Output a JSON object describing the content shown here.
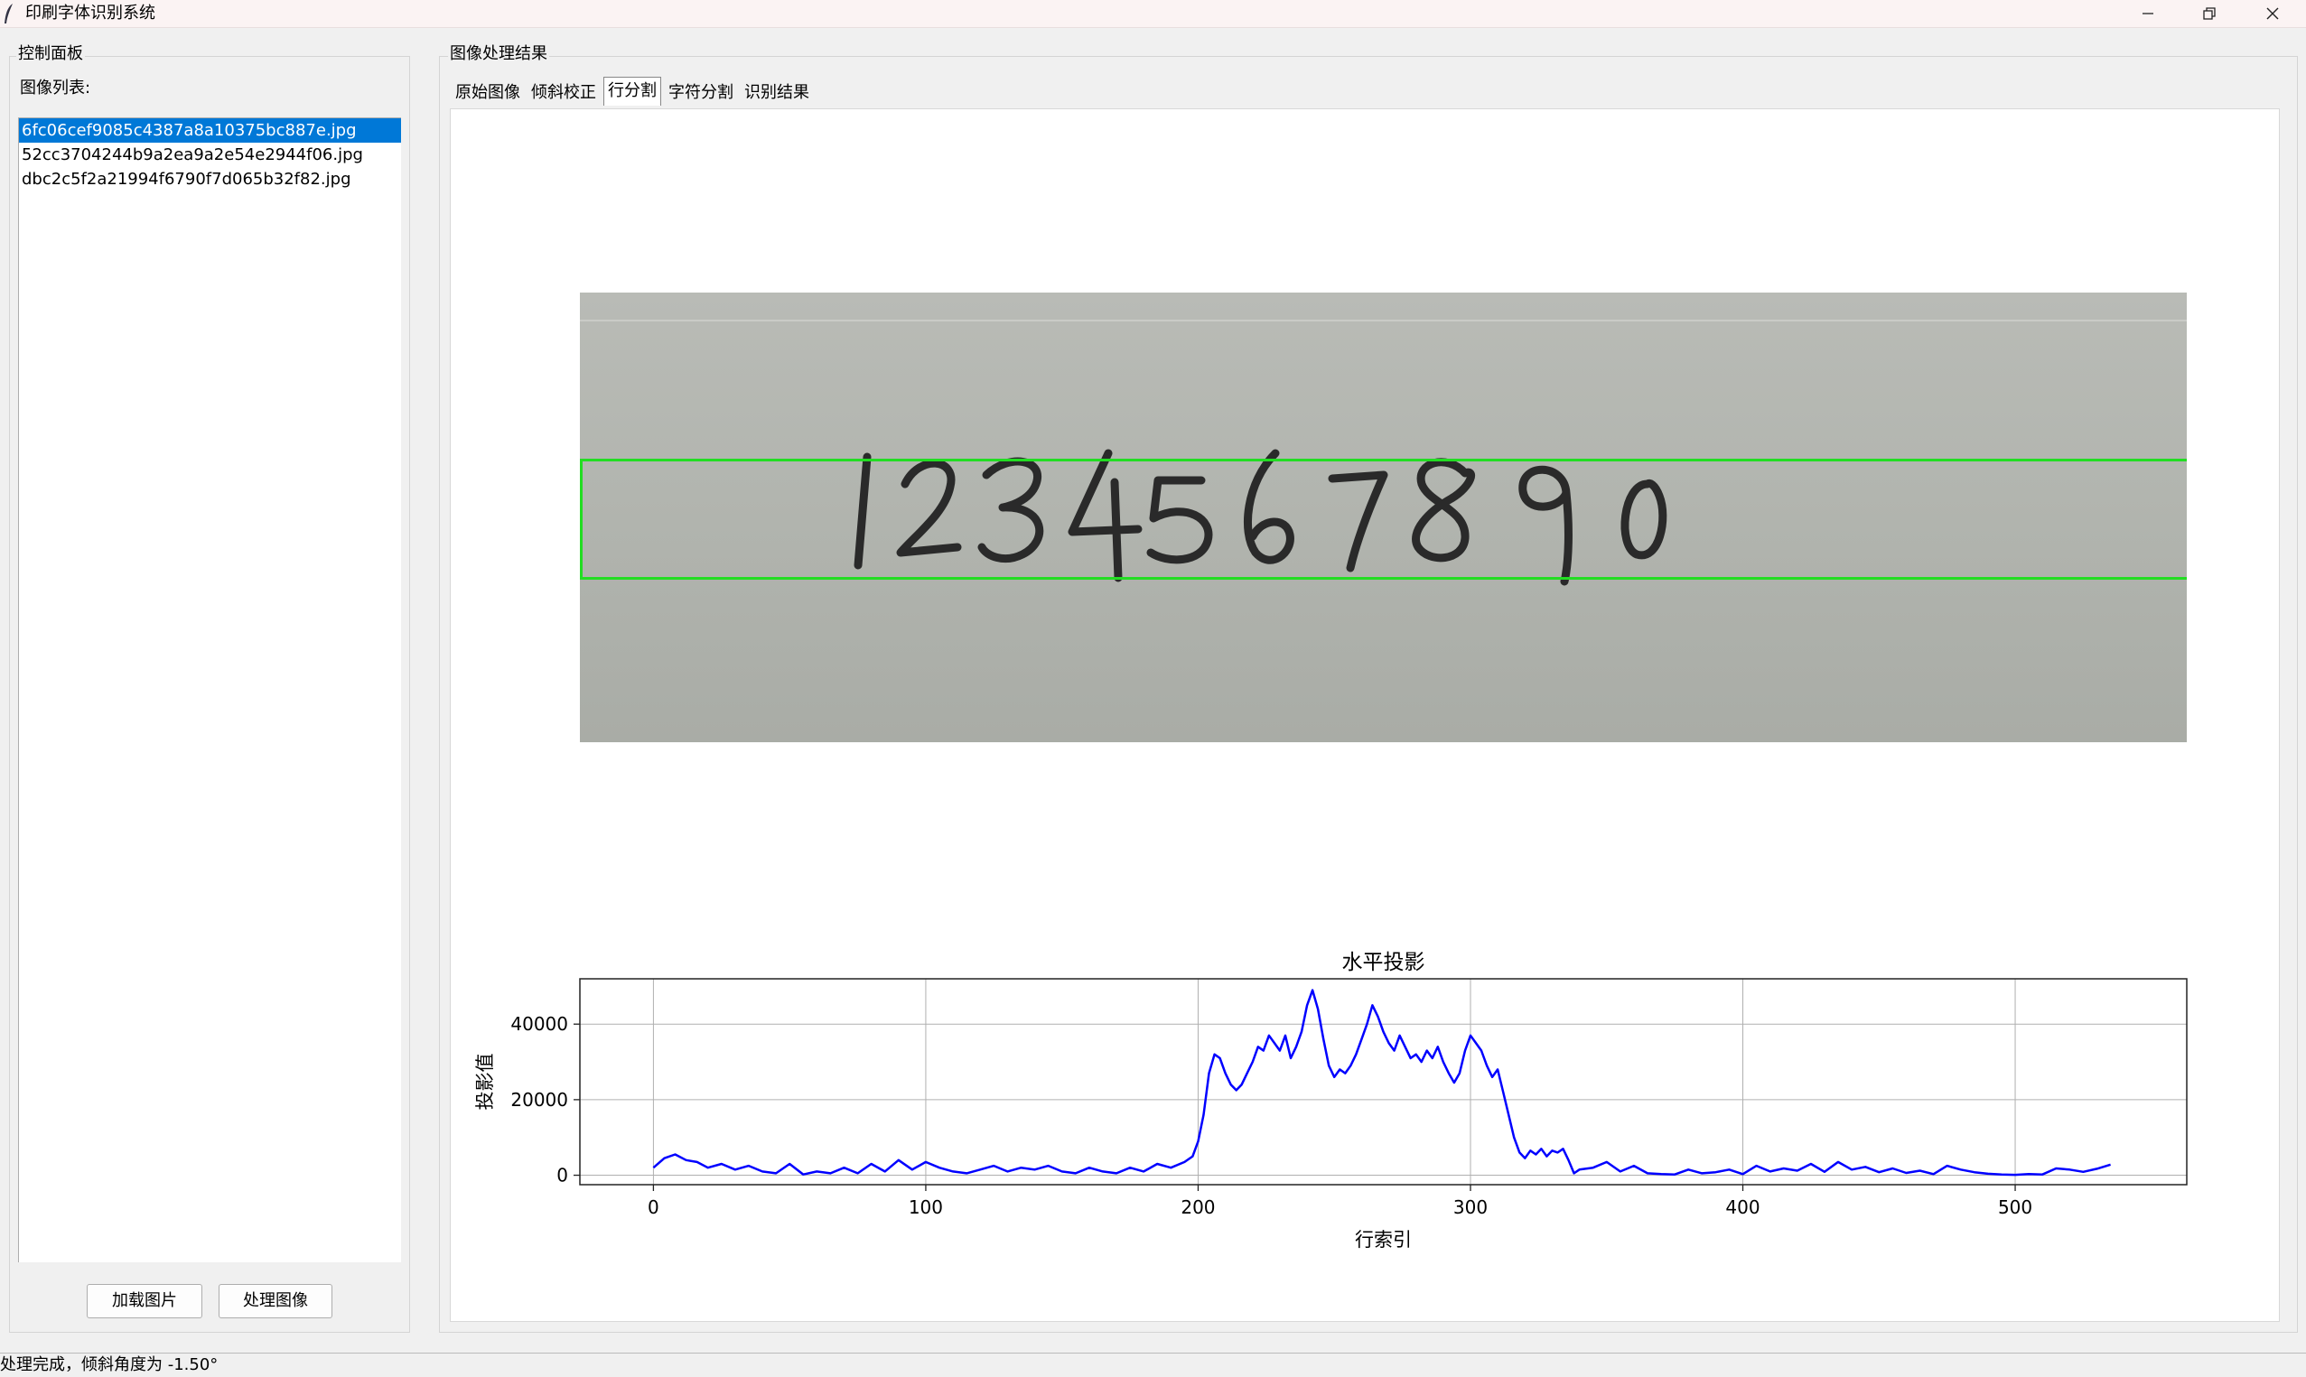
{
  "window": {
    "title": "印刷字体识别系统",
    "controls": [
      "minimize",
      "restore",
      "close"
    ]
  },
  "control_panel": {
    "title": "控制面板",
    "list_label": "图像列表:",
    "images": [
      "6fc06cef9085c4387a8a10375bc887e.jpg",
      "52cc3704244b9a2ea9a2e54e2944f06.jpg",
      "dbc2c5f2a21994f6790f7d065b32f82.jpg"
    ],
    "selected_index": 0,
    "load_button": "加载图片",
    "process_button": "处理图像"
  },
  "results": {
    "title": "图像处理结果",
    "tabs": [
      "原始图像",
      "倾斜校正",
      "行分割",
      "字符分割",
      "识别结果"
    ],
    "active_tab": 2
  },
  "chart_data": {
    "type": "line",
    "title": "水平投影",
    "xlabel": "行索引",
    "ylabel": "投影值",
    "xlim": [
      -27,
      563
    ],
    "ylim": [
      -2500,
      52000
    ],
    "xticks": [
      0,
      100,
      200,
      300,
      400,
      500
    ],
    "yticks": [
      0,
      20000,
      40000
    ],
    "grid": true,
    "color": "#0000ff",
    "x": [
      0,
      4,
      8,
      12,
      16,
      20,
      25,
      30,
      35,
      40,
      45,
      50,
      55,
      60,
      65,
      70,
      75,
      80,
      85,
      90,
      95,
      100,
      105,
      110,
      115,
      120,
      125,
      130,
      135,
      140,
      145,
      150,
      155,
      160,
      165,
      170,
      175,
      180,
      185,
      190,
      195,
      198,
      200,
      202,
      204,
      206,
      208,
      210,
      212,
      214,
      216,
      218,
      220,
      222,
      224,
      226,
      228,
      230,
      232,
      234,
      236,
      238,
      240,
      242,
      244,
      246,
      248,
      250,
      252,
      254,
      256,
      258,
      260,
      262,
      264,
      266,
      268,
      270,
      272,
      274,
      276,
      278,
      280,
      282,
      284,
      286,
      288,
      290,
      292,
      294,
      296,
      298,
      300,
      302,
      304,
      306,
      308,
      310,
      312,
      314,
      316,
      318,
      320,
      322,
      324,
      326,
      328,
      330,
      332,
      334,
      336,
      338,
      340,
      345,
      350,
      355,
      360,
      365,
      370,
      375,
      380,
      385,
      390,
      395,
      400,
      405,
      410,
      415,
      420,
      425,
      430,
      435,
      440,
      445,
      450,
      455,
      460,
      465,
      470,
      475,
      480,
      485,
      490,
      495,
      500,
      505,
      510,
      515,
      520,
      525,
      530,
      535
    ],
    "y": [
      2000,
      4500,
      5500,
      4000,
      3500,
      2000,
      3000,
      1500,
      2500,
      1000,
      500,
      3000,
      200,
      1000,
      500,
      2000,
      500,
      3000,
      1000,
      4000,
      1500,
      3500,
      2000,
      1000,
      500,
      1500,
      2500,
      1000,
      2000,
      1500,
      2500,
      1000,
      500,
      2000,
      1000,
      500,
      2000,
      1000,
      3000,
      2000,
      3500,
      5000,
      9000,
      16000,
      27000,
      32000,
      31000,
      27000,
      24000,
      22500,
      24000,
      27000,
      30000,
      34000,
      33000,
      37000,
      35000,
      33000,
      37000,
      31000,
      34000,
      38000,
      45000,
      49000,
      44000,
      36000,
      29000,
      26000,
      28000,
      27000,
      29000,
      32000,
      36000,
      40000,
      45000,
      42000,
      38000,
      35000,
      33000,
      37000,
      34000,
      31000,
      32000,
      30000,
      33000,
      31000,
      34000,
      30000,
      27000,
      24500,
      27000,
      33000,
      37000,
      35000,
      33000,
      29000,
      26000,
      28000,
      22000,
      16000,
      10000,
      6000,
      4500,
      6500,
      5500,
      7000,
      5000,
      6500,
      6000,
      7000,
      4000,
      500,
      1500,
      2000,
      3500,
      1000,
      2500,
      500,
      300,
      200,
      1500,
      500,
      800,
      1500,
      300,
      2500,
      1000,
      1800,
      1200,
      3000,
      900,
      3500,
      1500,
      2200,
      800,
      1800,
      600,
      1200,
      300,
      2500,
      1500,
      800,
      400,
      200,
      100,
      300,
      200,
      1800,
      1500,
      900,
      1700,
      2800
    ]
  },
  "status": {
    "text": "处理完成，倾斜角度为 -1.50°"
  }
}
